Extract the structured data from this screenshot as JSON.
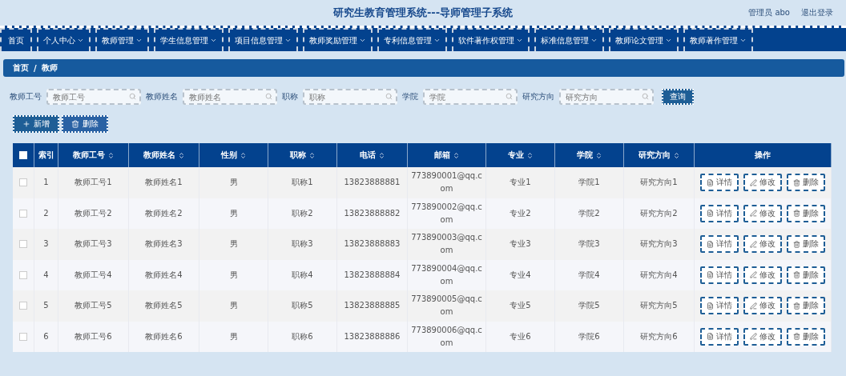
{
  "header": {
    "title": "研究生教育管理系统---导师管理子系统",
    "user": "管理员 abo",
    "logout": "退出登录"
  },
  "nav": [
    {
      "label": "首页",
      "dropdown": false
    },
    {
      "label": "个人中心",
      "dropdown": true
    },
    {
      "label": "教师管理",
      "dropdown": true
    },
    {
      "label": "学生信息管理",
      "dropdown": true
    },
    {
      "label": "项目信息管理",
      "dropdown": true
    },
    {
      "label": "教师奖励管理",
      "dropdown": true
    },
    {
      "label": "专利信息管理",
      "dropdown": true
    },
    {
      "label": "软件著作权管理",
      "dropdown": true
    },
    {
      "label": "标准信息管理",
      "dropdown": true
    },
    {
      "label": "教师论文管理",
      "dropdown": true
    },
    {
      "label": "教师著作管理",
      "dropdown": true
    }
  ],
  "breadcrumb": {
    "items": [
      "首页",
      "教师"
    ],
    "separator": "/"
  },
  "search": {
    "fields": [
      {
        "label": "教师工号",
        "placeholder": "教师工号"
      },
      {
        "label": "教师姓名",
        "placeholder": "教师姓名"
      },
      {
        "label": "职称",
        "placeholder": "职称"
      },
      {
        "label": "学院",
        "placeholder": "学院"
      },
      {
        "label": "研究方向",
        "placeholder": "研究方向"
      }
    ],
    "button": "查询"
  },
  "actions": [
    {
      "label": "新增",
      "kind": "add"
    },
    {
      "label": "删除",
      "kind": "delete"
    }
  ],
  "table": {
    "columns": [
      {
        "label": "索引",
        "sortable": false
      },
      {
        "label": "教师工号",
        "sortable": true
      },
      {
        "label": "教师姓名",
        "sortable": true
      },
      {
        "label": "性别",
        "sortable": true
      },
      {
        "label": "职称",
        "sortable": true
      },
      {
        "label": "电话",
        "sortable": true
      },
      {
        "label": "邮箱",
        "sortable": true
      },
      {
        "label": "专业",
        "sortable": true
      },
      {
        "label": "学院",
        "sortable": true
      },
      {
        "label": "研究方向",
        "sortable": true
      },
      {
        "label": "操作",
        "sortable": false
      }
    ],
    "header_checked": false,
    "rows": [
      {
        "checked": false,
        "cells": [
          "1",
          "教师工号1",
          "教师姓名1",
          "男",
          "职称1",
          "13823888881",
          "773890001@qq.com",
          "专业1",
          "学院1",
          "研究方向1"
        ],
        "actions": [
          {
            "label": "详情",
            "kind": "detail"
          },
          {
            "label": "修改",
            "kind": "edit"
          },
          {
            "label": "删除",
            "kind": "delete"
          }
        ]
      },
      {
        "checked": false,
        "cells": [
          "2",
          "教师工号2",
          "教师姓名2",
          "男",
          "职称2",
          "13823888882",
          "773890002@qq.com",
          "专业2",
          "学院2",
          "研究方向2"
        ],
        "actions": [
          {
            "label": "详情",
            "kind": "detail"
          },
          {
            "label": "修改",
            "kind": "edit"
          },
          {
            "label": "删除",
            "kind": "delete"
          }
        ]
      },
      {
        "checked": false,
        "cells": [
          "3",
          "教师工号3",
          "教师姓名3",
          "男",
          "职称3",
          "13823888883",
          "773890003@qq.com",
          "专业3",
          "学院3",
          "研究方向3"
        ],
        "actions": [
          {
            "label": "详情",
            "kind": "detail"
          },
          {
            "label": "修改",
            "kind": "edit"
          },
          {
            "label": "删除",
            "kind": "delete"
          }
        ]
      },
      {
        "checked": false,
        "cells": [
          "4",
          "教师工号4",
          "教师姓名4",
          "男",
          "职称4",
          "13823888884",
          "773890004@qq.com",
          "专业4",
          "学院4",
          "研究方向4"
        ],
        "actions": [
          {
            "label": "详情",
            "kind": "detail"
          },
          {
            "label": "修改",
            "kind": "edit"
          },
          {
            "label": "删除",
            "kind": "delete"
          }
        ]
      },
      {
        "checked": false,
        "cells": [
          "5",
          "教师工号5",
          "教师姓名5",
          "男",
          "职称5",
          "13823888885",
          "773890005@qq.com",
          "专业5",
          "学院5",
          "研究方向5"
        ],
        "actions": [
          {
            "label": "详情",
            "kind": "detail"
          },
          {
            "label": "修改",
            "kind": "edit"
          },
          {
            "label": "删除",
            "kind": "delete"
          }
        ]
      },
      {
        "checked": false,
        "cells": [
          "6",
          "教师工号6",
          "教师姓名6",
          "男",
          "职称6",
          "13823888886",
          "773890006@qq.com",
          "专业6",
          "学院6",
          "研究方向6"
        ],
        "actions": [
          {
            "label": "详情",
            "kind": "detail"
          },
          {
            "label": "修改",
            "kind": "edit"
          },
          {
            "label": "删除",
            "kind": "delete"
          }
        ]
      }
    ]
  }
}
